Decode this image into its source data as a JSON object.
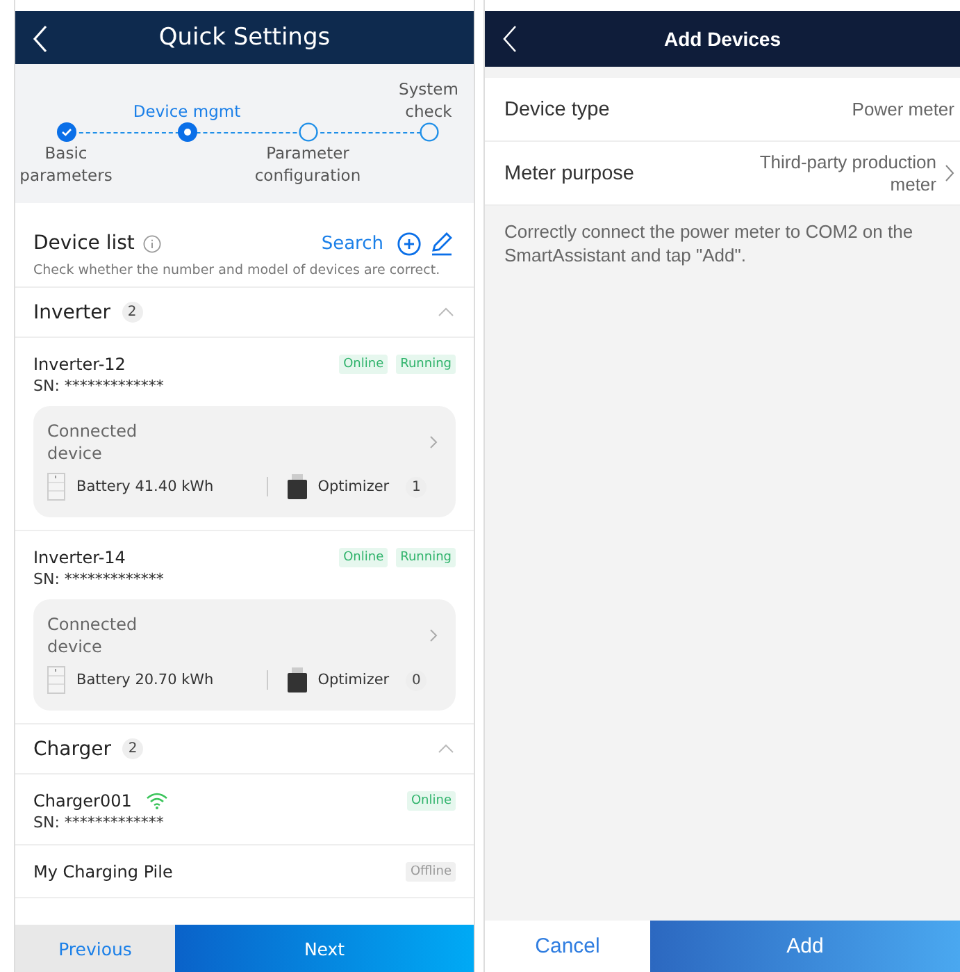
{
  "left": {
    "title": "Quick Settings",
    "steps": [
      {
        "label": "Basic parameters",
        "completed": true,
        "selected": false,
        "kind": "below"
      },
      {
        "label": "Device mgmt",
        "completed": false,
        "selected": true,
        "kind": "above"
      },
      {
        "label": "Parameter configuration",
        "completed": false,
        "selected": false,
        "kind": "below"
      },
      {
        "label": "System check",
        "completed": false,
        "selected": false,
        "kind": "above"
      }
    ],
    "device_list": {
      "title": "Device list",
      "search": "Search",
      "hint": "Check whether the number and model of devices are correct."
    },
    "groups": [
      {
        "name": "Inverter",
        "count": "2",
        "expanded": true,
        "devices": [
          {
            "name": "Inverter-12",
            "sn": "SN: *************",
            "wifi": false,
            "tags": [
              {
                "label": "Online",
                "kind": "online"
              },
              {
                "label": "Running",
                "kind": "running"
              }
            ],
            "connected": {
              "title": "Connected device",
              "battery": "Battery 41.40 kWh",
              "optimizer": "Optimizer",
              "optimizer_count": "1"
            }
          },
          {
            "name": "Inverter-14",
            "sn": "SN: *************",
            "wifi": false,
            "tags": [
              {
                "label": "Online",
                "kind": "online"
              },
              {
                "label": "Running",
                "kind": "running"
              }
            ],
            "connected": {
              "title": "Connected device",
              "battery": "Battery 20.70 kWh",
              "optimizer": "Optimizer",
              "optimizer_count": "0"
            }
          }
        ]
      },
      {
        "name": "Charger",
        "count": "2",
        "expanded": true,
        "devices": [
          {
            "name": "Charger001",
            "sn": "SN: *************",
            "wifi": true,
            "tags": [
              {
                "label": "Online",
                "kind": "online"
              }
            ]
          },
          {
            "name": "My Charging Pile",
            "wifi": false,
            "tags": [
              {
                "label": "Offline",
                "kind": "offline"
              }
            ]
          }
        ]
      }
    ],
    "buttons": {
      "previous": "Previous",
      "next": "Next"
    }
  },
  "right": {
    "title": "Add Devices",
    "rows": [
      {
        "label": "Device type",
        "value": "Power meter",
        "kind": "static"
      },
      {
        "label": "Meter purpose",
        "value": "Third-party production meter",
        "kind": "select"
      }
    ],
    "note": "Correctly connect the power meter to COM2 on the SmartAssistant and tap \"Add\".",
    "buttons": {
      "cancel": "Cancel",
      "add": "Add"
    }
  }
}
